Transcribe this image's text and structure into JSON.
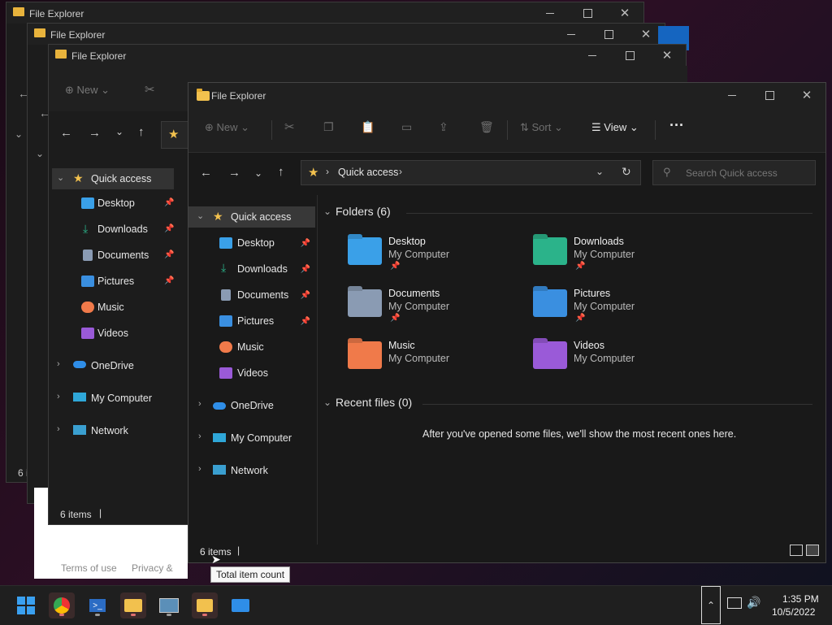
{
  "bg_windows": [
    {
      "title": "File Explorer",
      "status": "6 i"
    },
    {
      "title": "File Explorer",
      "status": "6 i"
    },
    {
      "title": "File Explorer",
      "status": "6 items"
    }
  ],
  "bg_footer": {
    "terms": "Terms of use",
    "privacy": "Privacy &"
  },
  "bg3": {
    "new_label": "New",
    "quick_access": "Quick access",
    "items": [
      "Desktop",
      "Downloads",
      "Documents",
      "Pictures",
      "Music",
      "Videos"
    ],
    "roots": [
      "OneDrive",
      "My Computer",
      "Network"
    ]
  },
  "window": {
    "title": "File Explorer",
    "commands": {
      "new": "New",
      "sort": "Sort",
      "view": "View"
    },
    "address": "Quick access",
    "search_placeholder": "Search Quick access",
    "status": "6 items"
  },
  "sidebar": {
    "quick_access": "Quick access",
    "items": [
      "Desktop",
      "Downloads",
      "Documents",
      "Pictures",
      "Music",
      "Videos"
    ],
    "roots": [
      "OneDrive",
      "My Computer",
      "Network"
    ]
  },
  "folders_header": "Folders (6)",
  "folders": [
    {
      "name": "Desktop",
      "loc": "My Computer",
      "color": "#3aa0e8"
    },
    {
      "name": "Downloads",
      "loc": "My Computer",
      "color": "#2bb38a"
    },
    {
      "name": "Documents",
      "loc": "My Computer",
      "color": "#8a9bb3"
    },
    {
      "name": "Pictures",
      "loc": "My Computer",
      "color": "#3a8fe0"
    },
    {
      "name": "Music",
      "loc": "My Computer",
      "color": "#f07a4a"
    },
    {
      "name": "Videos",
      "loc": "My Computer",
      "color": "#9a5ad8"
    }
  ],
  "recent_header": "Recent files (0)",
  "recent_empty": "After you've opened some files, we'll show the most recent ones here.",
  "tooltip": "Total item count",
  "taskbar": {
    "time": "1:35 PM",
    "date": "10/5/2022",
    "icons": [
      "windows-start-icon",
      "chrome-icon",
      "powershell-icon",
      "file-explorer-icon",
      "resource-monitor-icon",
      "file-explorer-user-icon",
      "mail-icon"
    ]
  }
}
